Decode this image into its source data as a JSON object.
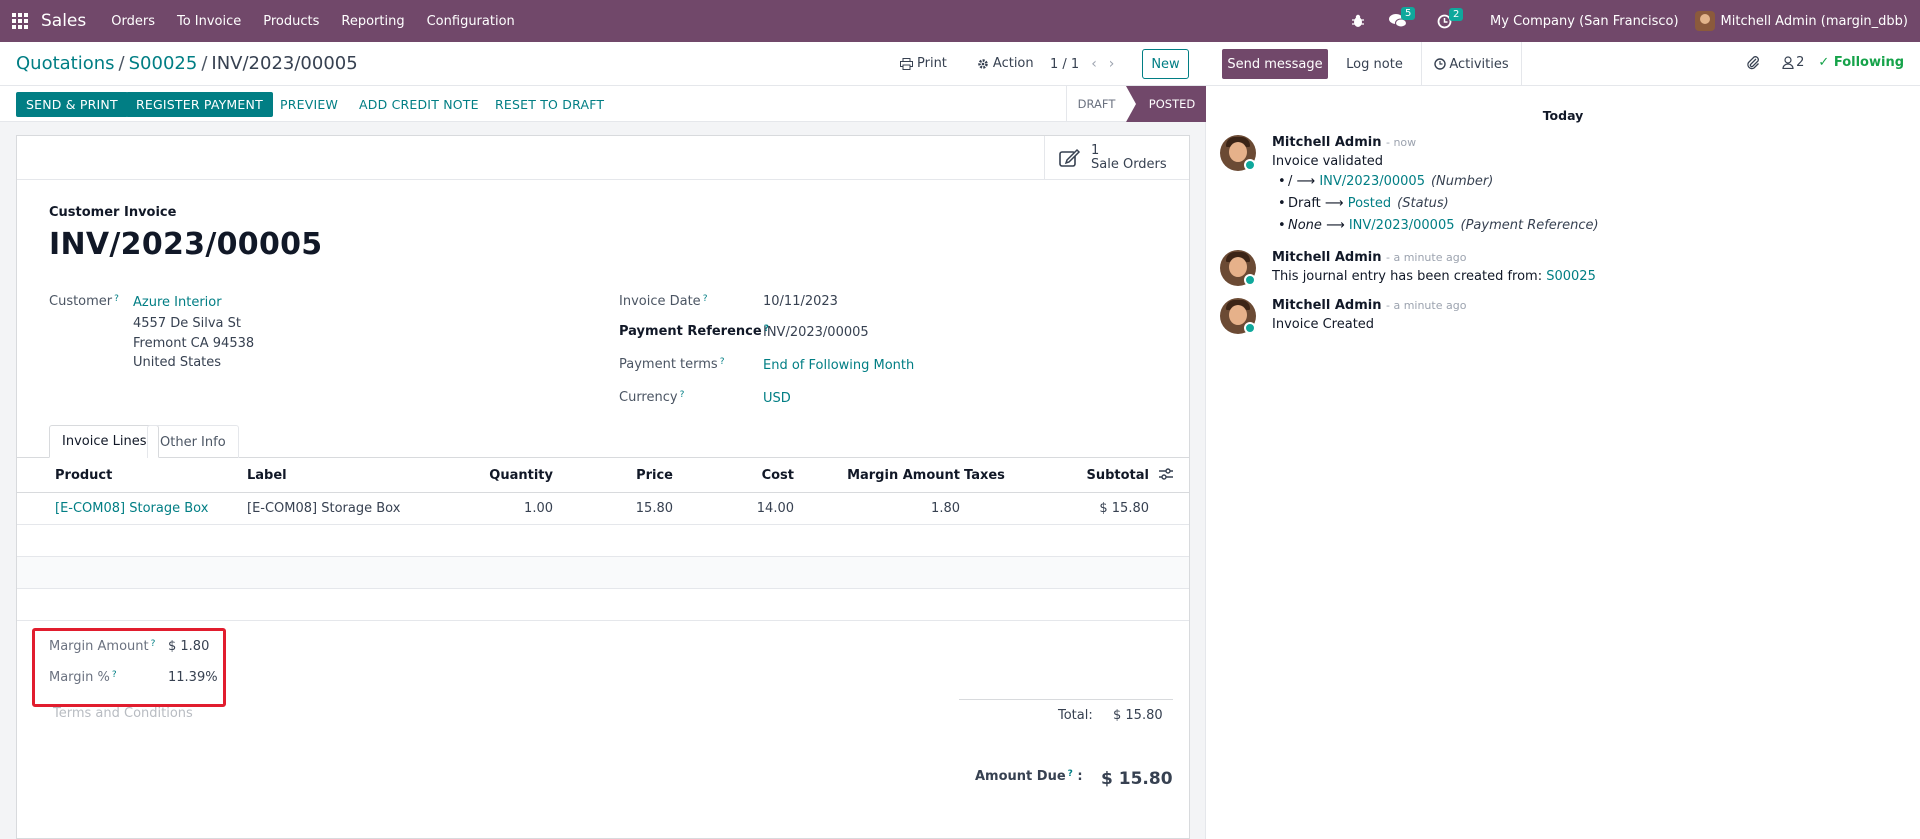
{
  "navbar": {
    "app_name": "Sales",
    "menu": [
      "Orders",
      "To Invoice",
      "Products",
      "Reporting",
      "Configuration"
    ],
    "messages_count": "5",
    "activities_count": "2",
    "company": "My Company (San Francisco)",
    "user": "Mitchell Admin (margin_dbb)",
    "accent_color": "#71486a"
  },
  "breadcrumb": {
    "root": "Quotations",
    "order": "S00025",
    "current": "INV/2023/00005"
  },
  "control": {
    "print_label": "Print",
    "action_label": "Action",
    "pager": "1 / 1",
    "new_label": "New"
  },
  "statusbar": {
    "send_print": "SEND & PRINT",
    "register_payment": "REGISTER PAYMENT",
    "preview": "PREVIEW",
    "add_credit_note": "ADD CREDIT NOTE",
    "reset_to_draft": "RESET TO DRAFT",
    "stage_draft": "DRAFT",
    "stage_posted": "POSTED"
  },
  "smart_button": {
    "count": "1",
    "label": "Sale Orders"
  },
  "invoice": {
    "type": "Customer Invoice",
    "name": "INV/2023/00005",
    "customer_label": "Customer",
    "customer_name": "Azure Interior",
    "address": [
      "4557 De Silva St",
      "Fremont CA 94538",
      "United States"
    ],
    "invoice_date_label": "Invoice Date",
    "invoice_date": "10/11/2023",
    "payment_ref_label": "Payment Reference",
    "payment_ref": "INV/2023/00005",
    "payment_terms_label": "Payment terms",
    "payment_terms": "End of Following Month",
    "currency_label": "Currency",
    "currency": "USD"
  },
  "tabs": [
    "Invoice Lines",
    "Other Info"
  ],
  "table": {
    "headers": [
      "Product",
      "Label",
      "Quantity",
      "Price",
      "Cost",
      "Margin Amount",
      "Taxes",
      "Subtotal"
    ],
    "rows": [
      {
        "product": "[E-COM08] Storage Box",
        "label": "[E-COM08] Storage Box",
        "quantity": "1.00",
        "price": "15.80",
        "cost": "14.00",
        "margin": "1.80",
        "taxes": "",
        "subtotal": "$ 15.80"
      }
    ]
  },
  "margin": {
    "amount_label": "Margin Amount",
    "amount": "$ 1.80",
    "percent_label": "Margin %",
    "percent": "11.39%"
  },
  "terms_placeholder": "Terms and Conditions",
  "totals": {
    "total_label": "Total:",
    "total": "$ 15.80",
    "due_label": "Amount Due",
    "due": "$ 15.80"
  },
  "chatter": {
    "send_message": "Send message",
    "log_note": "Log note",
    "activities": "Activities",
    "followers_count": "2",
    "following": "Following",
    "date_sep": "Today",
    "messages": [
      {
        "author": "Mitchell Admin",
        "time": "- now",
        "body": "Invoice validated",
        "tracking": [
          {
            "old": "/",
            "new": "INV/2023/00005",
            "field": "(Number)"
          },
          {
            "old": "Draft",
            "new": "Posted",
            "field": "(Status)"
          },
          {
            "old": "None",
            "new": "INV/2023/00005",
            "field": "(Payment Reference)"
          }
        ]
      },
      {
        "author": "Mitchell Admin",
        "time": "- a minute ago",
        "body": "This journal entry has been created from:",
        "link": "S00025"
      },
      {
        "author": "Mitchell Admin",
        "time": "- a minute ago",
        "body": "Invoice Created"
      }
    ]
  }
}
